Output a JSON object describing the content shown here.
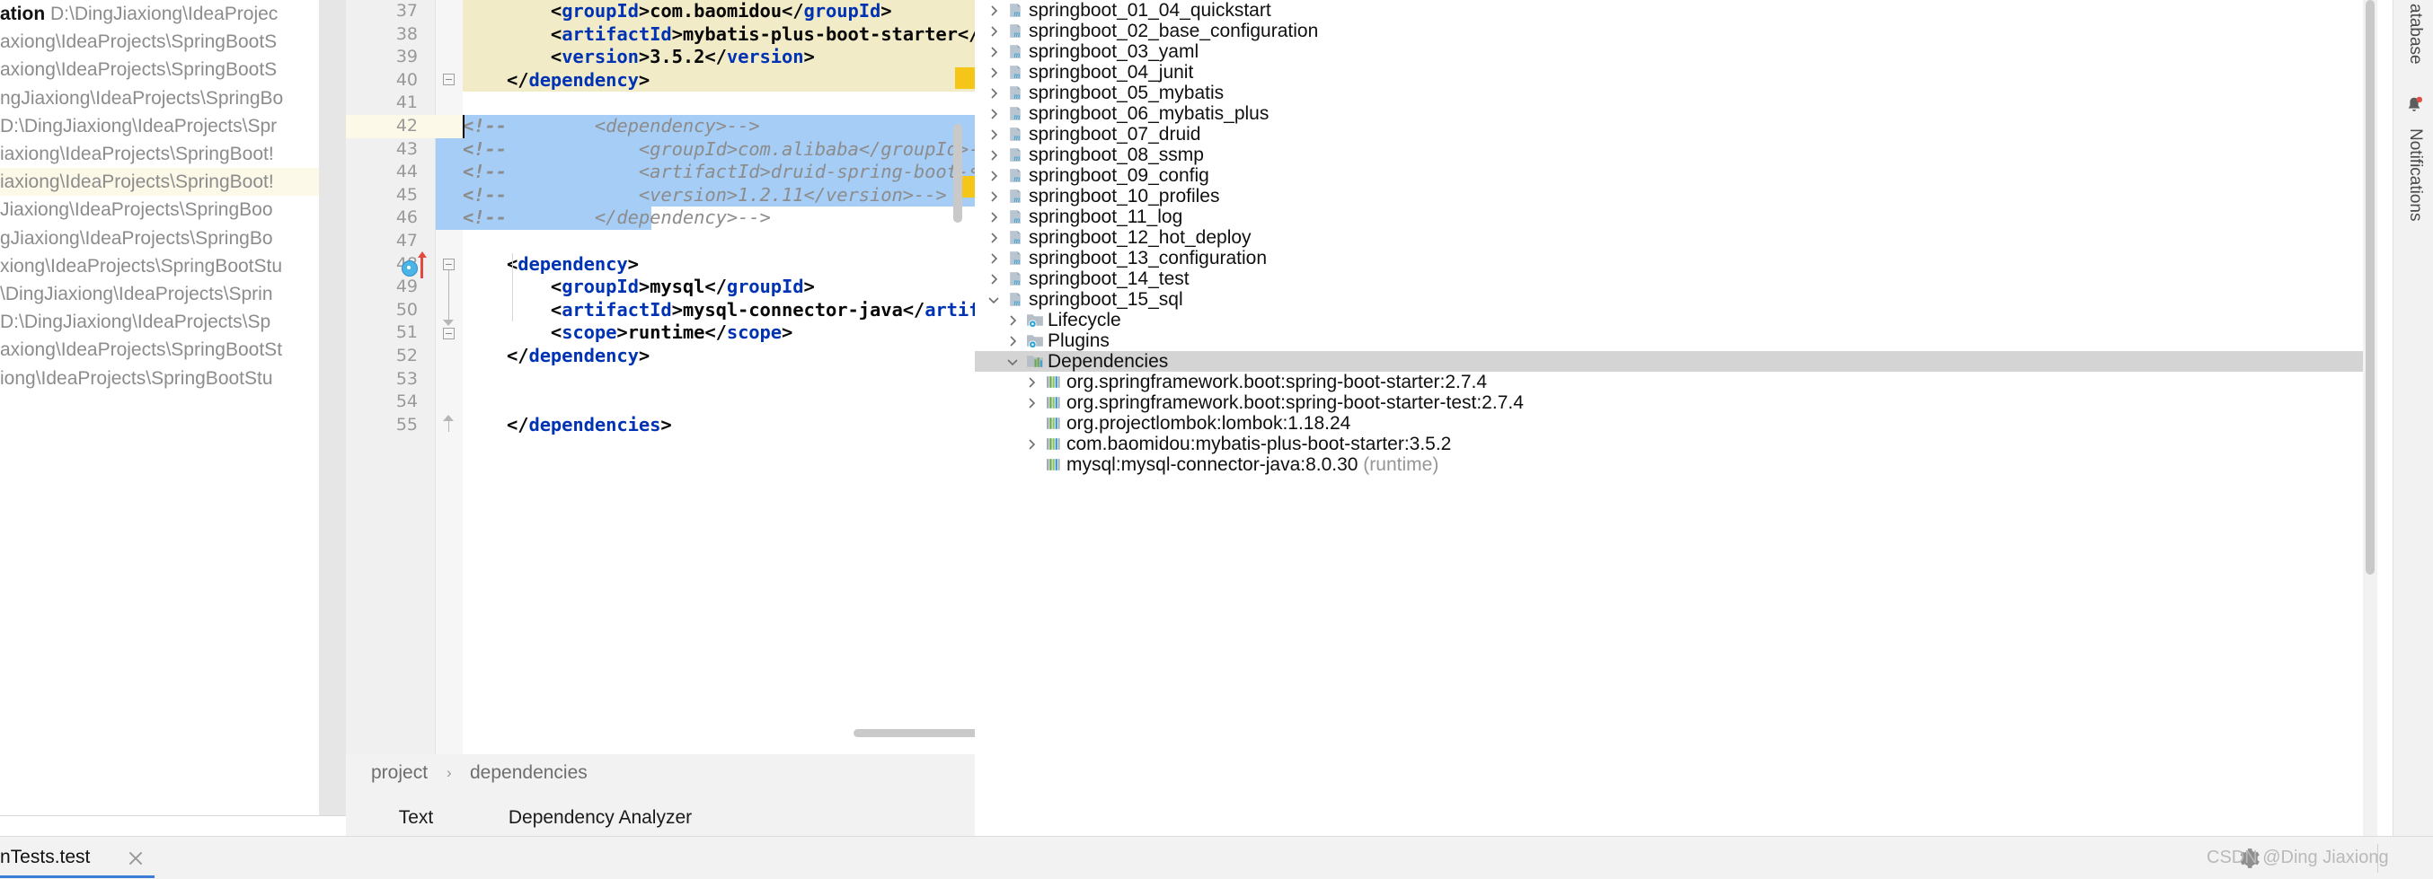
{
  "left_panel": {
    "title": "ation",
    "rows": [
      {
        "bold": "ation",
        "path": "D:\\DingJiaxiong\\IdeaProjec"
      },
      {
        "bold": "",
        "path": "axiong\\IdeaProjects\\SpringBootS"
      },
      {
        "bold": "",
        "path": "axiong\\IdeaProjects\\SpringBootS"
      },
      {
        "bold": "",
        "path": "ngJiaxiong\\IdeaProjects\\SpringBo"
      },
      {
        "bold": "",
        "path": "D:\\DingJiaxiong\\IdeaProjects\\Spr"
      },
      {
        "bold": "",
        "path": "iaxiong\\IdeaProjects\\SpringBoot!"
      },
      {
        "bold": "",
        "path": "iaxiong\\IdeaProjects\\SpringBoot!"
      },
      {
        "bold": "",
        "path": "Jiaxiong\\IdeaProjects\\SpringBoo"
      },
      {
        "bold": "",
        "path": "gJiaxiong\\IdeaProjects\\SpringBo"
      },
      {
        "bold": "",
        "path": "xiong\\IdeaProjects\\SpringBootStu"
      },
      {
        "bold": "",
        "path": "\\DingJiaxiong\\IdeaProjects\\Sprin"
      },
      {
        "bold": "",
        "path": "D:\\DingJiaxiong\\IdeaProjects\\Sp"
      },
      {
        "bold": "",
        "path": "axiong\\IdeaProjects\\SpringBootSt"
      },
      {
        "bold": "",
        "path": "iong\\IdeaProjects\\SpringBootStu"
      }
    ]
  },
  "editor": {
    "lines": [
      {
        "num": "37",
        "text": "        <groupId>com.baomidou</groupId>"
      },
      {
        "num": "38",
        "text": "        <artifactId>mybatis-plus-boot-starter</artifactId>"
      },
      {
        "num": "39",
        "text": "        <version>3.5.2</version>"
      },
      {
        "num": "40",
        "text": "    </dependency>"
      },
      {
        "num": "41",
        "text": ""
      },
      {
        "num": "42",
        "text": "<!--        <dependency>-->"
      },
      {
        "num": "43",
        "text": "<!--            <groupId>com.alibaba</groupId>-->"
      },
      {
        "num": "44",
        "text": "<!--            <artifactId>druid-spring-boot-starter</artifactId>-->"
      },
      {
        "num": "45",
        "text": "<!--            <version>1.2.11</version>-->"
      },
      {
        "num": "46",
        "text": "<!--        </dependency>-->"
      },
      {
        "num": "47",
        "text": ""
      },
      {
        "num": "48",
        "text": "    <dependency>"
      },
      {
        "num": "49",
        "text": "        <groupId>mysql</groupId>"
      },
      {
        "num": "50",
        "text": "        <artifactId>mysql-connector-java</artifactId>"
      },
      {
        "num": "51",
        "text": "        <scope>runtime</scope>"
      },
      {
        "num": "52",
        "text": "    </dependency>"
      },
      {
        "num": "53",
        "text": ""
      },
      {
        "num": "54",
        "text": ""
      },
      {
        "num": "55",
        "text": "    </dependencies>"
      }
    ],
    "breadcrumb": {
      "project": "project",
      "separator": "›",
      "dependencies": "dependencies"
    },
    "tabs": [
      {
        "label": "Text",
        "active": true
      },
      {
        "label": "Dependency Analyzer",
        "active": false
      }
    ]
  },
  "tree": {
    "items": [
      {
        "label": "springboot_01_04_quickstart",
        "indent": 0,
        "chevron": "right",
        "icon": "maven-module-icon",
        "selected": false,
        "dim": ""
      },
      {
        "label": "springboot_02_base_configuration",
        "indent": 0,
        "chevron": "right",
        "icon": "maven-module-icon",
        "selected": false,
        "dim": ""
      },
      {
        "label": "springboot_03_yaml",
        "indent": 0,
        "chevron": "right",
        "icon": "maven-module-icon",
        "selected": false,
        "dim": ""
      },
      {
        "label": "springboot_04_junit",
        "indent": 0,
        "chevron": "right",
        "icon": "maven-module-icon",
        "selected": false,
        "dim": ""
      },
      {
        "label": "springboot_05_mybatis",
        "indent": 0,
        "chevron": "right",
        "icon": "maven-module-icon",
        "selected": false,
        "dim": ""
      },
      {
        "label": "springboot_06_mybatis_plus",
        "indent": 0,
        "chevron": "right",
        "icon": "maven-module-icon",
        "selected": false,
        "dim": ""
      },
      {
        "label": "springboot_07_druid",
        "indent": 0,
        "chevron": "right",
        "icon": "maven-module-icon",
        "selected": false,
        "dim": ""
      },
      {
        "label": "springboot_08_ssmp",
        "indent": 0,
        "chevron": "right",
        "icon": "maven-module-icon",
        "selected": false,
        "dim": ""
      },
      {
        "label": "springboot_09_config",
        "indent": 0,
        "chevron": "right",
        "icon": "maven-module-icon",
        "selected": false,
        "dim": ""
      },
      {
        "label": "springboot_10_profiles",
        "indent": 0,
        "chevron": "right",
        "icon": "maven-module-icon",
        "selected": false,
        "dim": ""
      },
      {
        "label": "springboot_11_log",
        "indent": 0,
        "chevron": "right",
        "icon": "maven-module-icon",
        "selected": false,
        "dim": ""
      },
      {
        "label": "springboot_12_hot_deploy",
        "indent": 0,
        "chevron": "right",
        "icon": "maven-module-icon",
        "selected": false,
        "dim": ""
      },
      {
        "label": "springboot_13_configuration",
        "indent": 0,
        "chevron": "right",
        "icon": "maven-module-icon",
        "selected": false,
        "dim": ""
      },
      {
        "label": "springboot_14_test",
        "indent": 0,
        "chevron": "right",
        "icon": "maven-module-icon",
        "selected": false,
        "dim": ""
      },
      {
        "label": "springboot_15_sql",
        "indent": 0,
        "chevron": "down",
        "icon": "maven-module-icon",
        "selected": false,
        "dim": ""
      },
      {
        "label": "Lifecycle",
        "indent": 1,
        "chevron": "right",
        "icon": "lifecycle-folder-icon",
        "selected": false,
        "dim": ""
      },
      {
        "label": "Plugins",
        "indent": 1,
        "chevron": "right",
        "icon": "plugins-folder-icon",
        "selected": false,
        "dim": ""
      },
      {
        "label": "Dependencies",
        "indent": 1,
        "chevron": "down",
        "icon": "dependencies-folder-icon",
        "selected": true,
        "dim": ""
      },
      {
        "label": "org.springframework.boot:spring-boot-starter:2.7.4",
        "indent": 2,
        "chevron": "right",
        "icon": "library-icon",
        "selected": false,
        "dim": ""
      },
      {
        "label": "org.springframework.boot:spring-boot-starter-test:2.7.4",
        "indent": 2,
        "chevron": "right",
        "icon": "library-icon",
        "selected": false,
        "dim": ""
      },
      {
        "label": "org.projectlombok:lombok:1.18.24",
        "indent": 2,
        "chevron": "none",
        "icon": "library-icon",
        "selected": false,
        "dim": ""
      },
      {
        "label": "com.baomidou:mybatis-plus-boot-starter:3.5.2",
        "indent": 2,
        "chevron": "right",
        "icon": "library-icon",
        "selected": false,
        "dim": ""
      },
      {
        "label": "mysql:mysql-connector-java:8.0.30",
        "indent": 2,
        "chevron": "none",
        "icon": "library-icon",
        "selected": false,
        "dim": "(runtime)"
      }
    ]
  },
  "toolstrip": {
    "database_label": "atabase",
    "notifications_label": "Notifications",
    "notification_icon": "bell-icon",
    "notification_badge_color": "#e0514b"
  },
  "bottom_bar": {
    "run_tab_label": "nTests.test",
    "close_icon": "close-icon",
    "watermark": "CSDN @Ding Jiaxiong",
    "watermark_gear_icon": "gear-icon"
  },
  "colors": {
    "tag_blue": "#0033b3",
    "comment_gray": "#8c8c8c",
    "selection_blue": "#a6cdf5",
    "highlight_yellow": "#f2ebc8",
    "caret_line": "#fdf9e8",
    "accent_blue": "#3d7dd8",
    "tree_selection": "#d4d4d4"
  }
}
